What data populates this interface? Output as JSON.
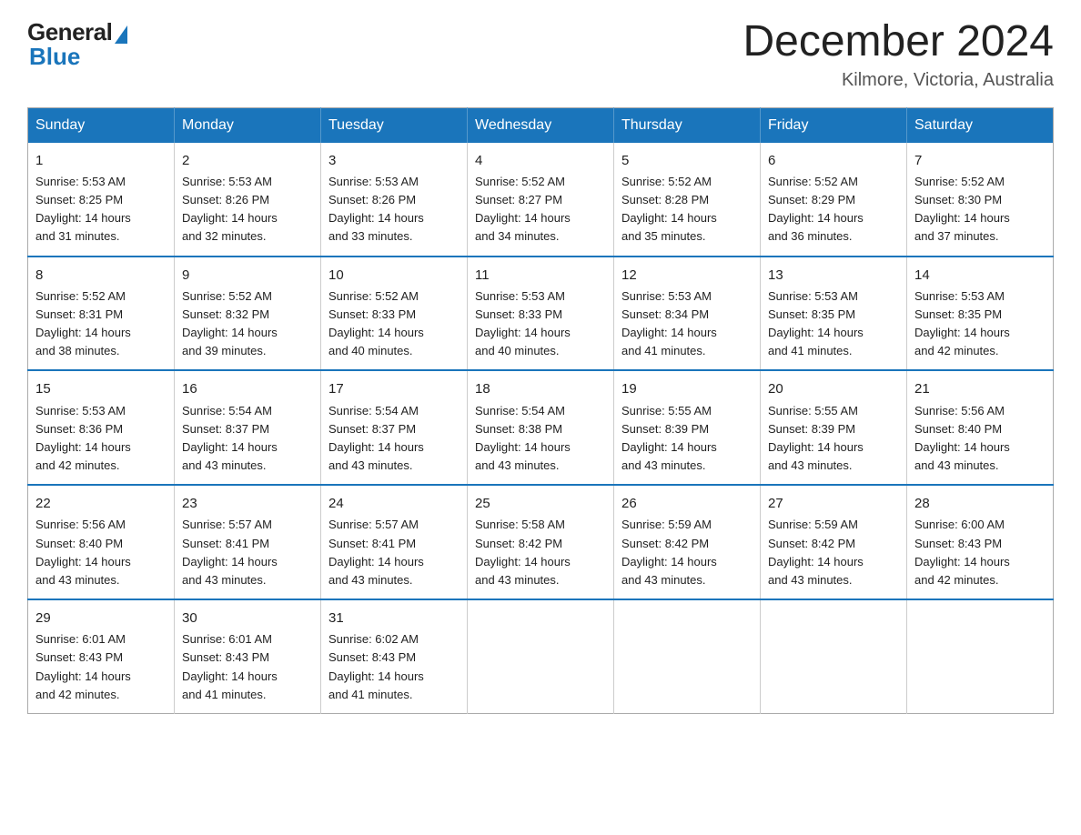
{
  "logo": {
    "general": "General",
    "blue": "Blue"
  },
  "title": {
    "month_year": "December 2024",
    "location": "Kilmore, Victoria, Australia"
  },
  "headers": [
    "Sunday",
    "Monday",
    "Tuesday",
    "Wednesday",
    "Thursday",
    "Friday",
    "Saturday"
  ],
  "weeks": [
    [
      {
        "day": "1",
        "sunrise": "5:53 AM",
        "sunset": "8:25 PM",
        "daylight": "14 hours and 31 minutes."
      },
      {
        "day": "2",
        "sunrise": "5:53 AM",
        "sunset": "8:26 PM",
        "daylight": "14 hours and 32 minutes."
      },
      {
        "day": "3",
        "sunrise": "5:53 AM",
        "sunset": "8:26 PM",
        "daylight": "14 hours and 33 minutes."
      },
      {
        "day": "4",
        "sunrise": "5:52 AM",
        "sunset": "8:27 PM",
        "daylight": "14 hours and 34 minutes."
      },
      {
        "day": "5",
        "sunrise": "5:52 AM",
        "sunset": "8:28 PM",
        "daylight": "14 hours and 35 minutes."
      },
      {
        "day": "6",
        "sunrise": "5:52 AM",
        "sunset": "8:29 PM",
        "daylight": "14 hours and 36 minutes."
      },
      {
        "day": "7",
        "sunrise": "5:52 AM",
        "sunset": "8:30 PM",
        "daylight": "14 hours and 37 minutes."
      }
    ],
    [
      {
        "day": "8",
        "sunrise": "5:52 AM",
        "sunset": "8:31 PM",
        "daylight": "14 hours and 38 minutes."
      },
      {
        "day": "9",
        "sunrise": "5:52 AM",
        "sunset": "8:32 PM",
        "daylight": "14 hours and 39 minutes."
      },
      {
        "day": "10",
        "sunrise": "5:52 AM",
        "sunset": "8:33 PM",
        "daylight": "14 hours and 40 minutes."
      },
      {
        "day": "11",
        "sunrise": "5:53 AM",
        "sunset": "8:33 PM",
        "daylight": "14 hours and 40 minutes."
      },
      {
        "day": "12",
        "sunrise": "5:53 AM",
        "sunset": "8:34 PM",
        "daylight": "14 hours and 41 minutes."
      },
      {
        "day": "13",
        "sunrise": "5:53 AM",
        "sunset": "8:35 PM",
        "daylight": "14 hours and 41 minutes."
      },
      {
        "day": "14",
        "sunrise": "5:53 AM",
        "sunset": "8:35 PM",
        "daylight": "14 hours and 42 minutes."
      }
    ],
    [
      {
        "day": "15",
        "sunrise": "5:53 AM",
        "sunset": "8:36 PM",
        "daylight": "14 hours and 42 minutes."
      },
      {
        "day": "16",
        "sunrise": "5:54 AM",
        "sunset": "8:37 PM",
        "daylight": "14 hours and 43 minutes."
      },
      {
        "day": "17",
        "sunrise": "5:54 AM",
        "sunset": "8:37 PM",
        "daylight": "14 hours and 43 minutes."
      },
      {
        "day": "18",
        "sunrise": "5:54 AM",
        "sunset": "8:38 PM",
        "daylight": "14 hours and 43 minutes."
      },
      {
        "day": "19",
        "sunrise": "5:55 AM",
        "sunset": "8:39 PM",
        "daylight": "14 hours and 43 minutes."
      },
      {
        "day": "20",
        "sunrise": "5:55 AM",
        "sunset": "8:39 PM",
        "daylight": "14 hours and 43 minutes."
      },
      {
        "day": "21",
        "sunrise": "5:56 AM",
        "sunset": "8:40 PM",
        "daylight": "14 hours and 43 minutes."
      }
    ],
    [
      {
        "day": "22",
        "sunrise": "5:56 AM",
        "sunset": "8:40 PM",
        "daylight": "14 hours and 43 minutes."
      },
      {
        "day": "23",
        "sunrise": "5:57 AM",
        "sunset": "8:41 PM",
        "daylight": "14 hours and 43 minutes."
      },
      {
        "day": "24",
        "sunrise": "5:57 AM",
        "sunset": "8:41 PM",
        "daylight": "14 hours and 43 minutes."
      },
      {
        "day": "25",
        "sunrise": "5:58 AM",
        "sunset": "8:42 PM",
        "daylight": "14 hours and 43 minutes."
      },
      {
        "day": "26",
        "sunrise": "5:59 AM",
        "sunset": "8:42 PM",
        "daylight": "14 hours and 43 minutes."
      },
      {
        "day": "27",
        "sunrise": "5:59 AM",
        "sunset": "8:42 PM",
        "daylight": "14 hours and 43 minutes."
      },
      {
        "day": "28",
        "sunrise": "6:00 AM",
        "sunset": "8:43 PM",
        "daylight": "14 hours and 42 minutes."
      }
    ],
    [
      {
        "day": "29",
        "sunrise": "6:01 AM",
        "sunset": "8:43 PM",
        "daylight": "14 hours and 42 minutes."
      },
      {
        "day": "30",
        "sunrise": "6:01 AM",
        "sunset": "8:43 PM",
        "daylight": "14 hours and 41 minutes."
      },
      {
        "day": "31",
        "sunrise": "6:02 AM",
        "sunset": "8:43 PM",
        "daylight": "14 hours and 41 minutes."
      },
      null,
      null,
      null,
      null
    ]
  ],
  "labels": {
    "sunrise": "Sunrise:",
    "sunset": "Sunset:",
    "daylight": "Daylight:"
  }
}
